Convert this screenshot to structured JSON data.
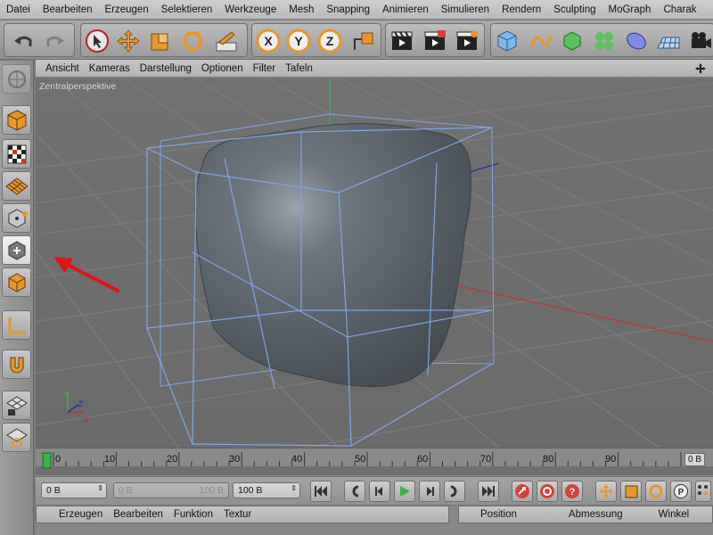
{
  "menubar": {
    "items": [
      "Datei",
      "Bearbeiten",
      "Erzeugen",
      "Selektieren",
      "Werkzeuge",
      "Mesh",
      "Snapping",
      "Animieren",
      "Simulieren",
      "Rendern",
      "Sculpting",
      "MoGraph",
      "Charak"
    ]
  },
  "toolbar": {
    "axis_x": "X",
    "axis_y": "Y",
    "axis_z": "Z"
  },
  "viewport": {
    "menu": [
      "Ansicht",
      "Kameras",
      "Darstellung",
      "Optionen",
      "Filter",
      "Tafeln"
    ],
    "label": "Zentralperspektive"
  },
  "timeline": {
    "ticks": [
      "0",
      "10",
      "20",
      "30",
      "40",
      "50",
      "60",
      "70",
      "80",
      "90"
    ],
    "current_frame": "0 B"
  },
  "controls": {
    "start": "0 B",
    "range_start": "0 B",
    "range_end": "100 B",
    "end": "100 B"
  },
  "bottom": {
    "objects_menu": [
      "Erzeugen",
      "Bearbeiten",
      "Funktion",
      "Textur"
    ],
    "coords_menu": [
      "Position",
      "Abmessung",
      "Winkel"
    ]
  },
  "colors": {
    "accent_orange": "#e8962a",
    "red_button": "#d84040",
    "play_green": "#3db24a",
    "annotation_arrow": "#e01515"
  }
}
